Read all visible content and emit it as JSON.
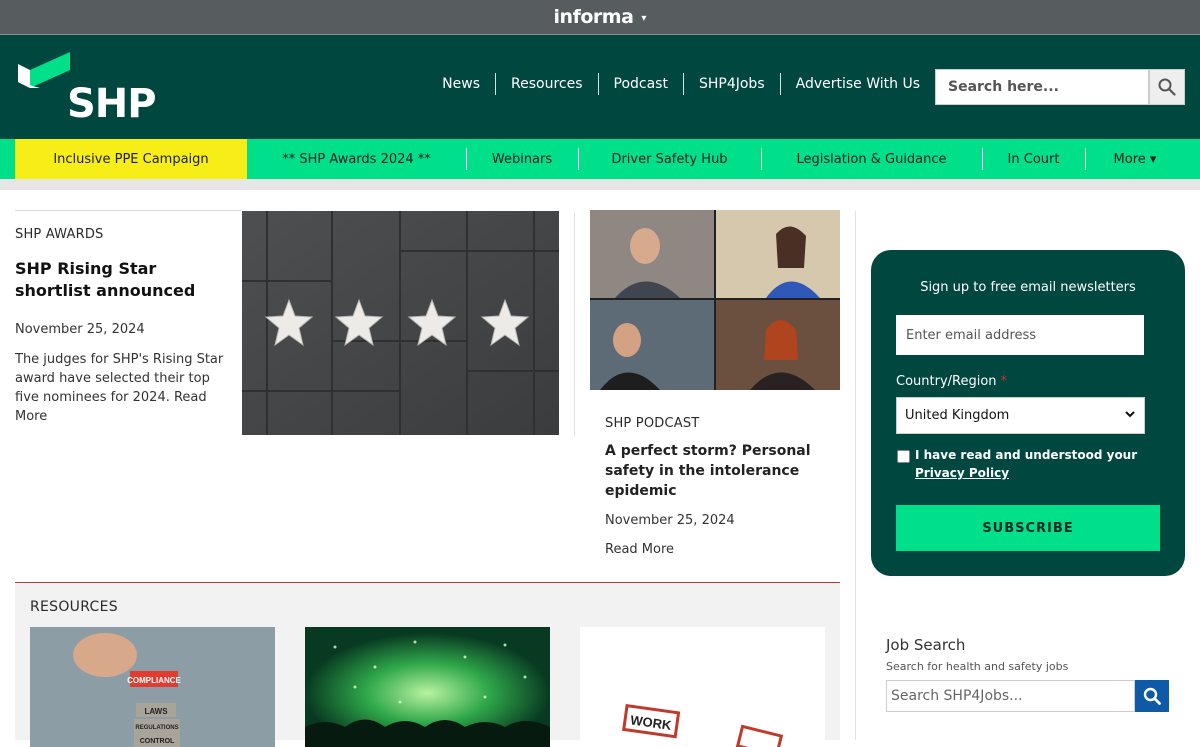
{
  "topbar": {
    "brand": "informa",
    "caret": "▾"
  },
  "header": {
    "logo_text": "SHP",
    "nav": [
      "News",
      "Resources",
      "Podcast",
      "SHP4Jobs",
      "Advertise With Us"
    ],
    "search_placeholder": "Search here..."
  },
  "subnav": {
    "items": [
      "Inclusive PPE Campaign",
      "** SHP Awards 2024 **",
      "Webinars",
      "Driver Safety Hub",
      "Legislation & Guidance",
      "In Court",
      "More ▾"
    ],
    "highlight_color": "#f7ee17"
  },
  "article1": {
    "kicker": "SHP AWARDS",
    "title": "SHP Rising Star shortlist announced",
    "date": "November 25, 2024",
    "excerpt": "The judges for SHP's Rising Star award have selected their top five nominees for 2024.  Read More"
  },
  "article2": {
    "kicker": "SHP PODCAST",
    "title": "A perfect storm? Personal safety in the intolerance epidemic",
    "date": "November 25, 2024",
    "read_more": "Read More"
  },
  "resources": {
    "title": "RESOURCES",
    "card_text": "WORK"
  },
  "newsletter": {
    "title": "Sign up to free email newsletters",
    "email_placeholder": "Enter email address",
    "country_label": "Country/Region",
    "required_mark": "*",
    "country_value": "United Kingdom",
    "consent_text": "I have read and understood your ",
    "consent_link": "Privacy Policy",
    "subscribe_label": "SUBSCRIBE"
  },
  "job_search": {
    "title": "Job Search",
    "subtitle": "Search for health and safety jobs",
    "placeholder": "Search SHP4Jobs..."
  },
  "colors": {
    "header_bg": "#00473f",
    "accent_green": "#00e08a",
    "topbar_bg": "#575c5f",
    "job_button": "#0e5aa7"
  }
}
